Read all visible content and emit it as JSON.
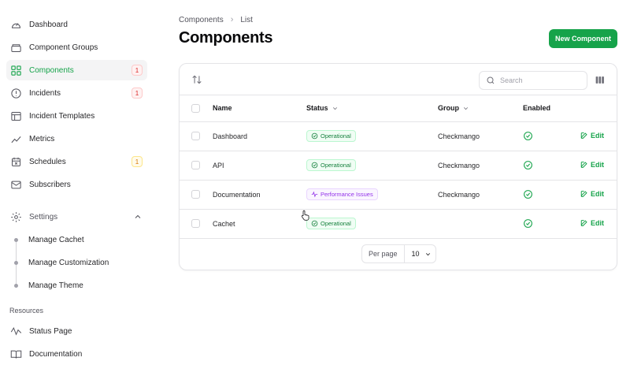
{
  "sidebar": {
    "items": [
      {
        "label": "Dashboard",
        "icon": "gauge-icon"
      },
      {
        "label": "Component Groups",
        "icon": "layers-icon"
      },
      {
        "label": "Components",
        "icon": "grid-icon",
        "badge": "1",
        "active": true
      },
      {
        "label": "Incidents",
        "icon": "alert-circle-icon",
        "badge": "1"
      },
      {
        "label": "Incident Templates",
        "icon": "template-icon"
      },
      {
        "label": "Metrics",
        "icon": "chart-line-icon"
      },
      {
        "label": "Schedules",
        "icon": "calendar-icon",
        "badge": "1"
      },
      {
        "label": "Subscribers",
        "icon": "mail-icon"
      }
    ],
    "settings": {
      "label": "Settings",
      "icon": "gear-icon",
      "children": [
        "Manage Cachet",
        "Manage Customization",
        "Manage Theme"
      ]
    },
    "resources": {
      "label": "Resources",
      "items": [
        {
          "label": "Status Page",
          "icon": "activity-icon"
        },
        {
          "label": "Documentation",
          "icon": "book-icon"
        }
      ]
    }
  },
  "header": {
    "breadcrumb": [
      "Components",
      "List"
    ],
    "title": "Components",
    "new_button": "New Component"
  },
  "toolbar": {
    "search_placeholder": "Search"
  },
  "table": {
    "columns": [
      "Name",
      "Status",
      "Group",
      "Enabled"
    ],
    "edit_label": "Edit",
    "rows": [
      {
        "name": "Dashboard",
        "status": "Operational",
        "status_kind": "ok",
        "group": "Checkmango",
        "enabled": true
      },
      {
        "name": "API",
        "status": "Operational",
        "status_kind": "ok",
        "group": "Checkmango",
        "enabled": true
      },
      {
        "name": "Documentation",
        "status": "Performance Issues",
        "status_kind": "perf",
        "group": "Checkmango",
        "enabled": true
      },
      {
        "name": "Cachet",
        "status": "Operational",
        "status_kind": "ok",
        "group": "",
        "enabled": true
      }
    ]
  },
  "pagination": {
    "per_page_label": "Per page",
    "per_page_value": "10"
  },
  "colors": {
    "accent": "#16a34a",
    "badge_red": "#dc2626",
    "badge_amber": "#d97706",
    "perf": "#9333ea"
  }
}
